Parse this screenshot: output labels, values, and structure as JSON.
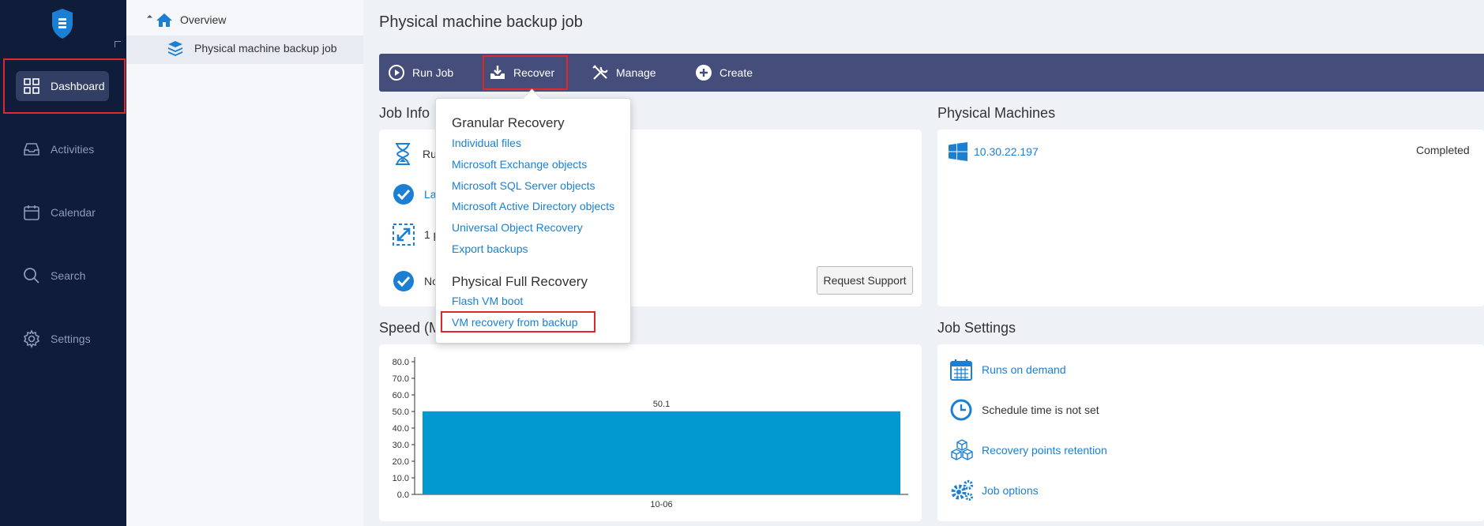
{
  "nav": {
    "items": [
      {
        "label": "Dashboard",
        "icon": "dashboard-grid-icon",
        "active": true
      },
      {
        "label": "Activities",
        "icon": "inbox-tray-icon"
      },
      {
        "label": "Calendar",
        "icon": "calendar-icon"
      },
      {
        "label": "Search",
        "icon": "search-icon"
      },
      {
        "label": "Settings",
        "icon": "gear-icon"
      }
    ]
  },
  "tree": {
    "overview": "Overview",
    "job": "Physical machine backup job"
  },
  "page": {
    "title": "Physical machine backup job"
  },
  "toolbar": {
    "run_job": "Run Job",
    "recover": "Recover",
    "manage": "Manage",
    "create": "Create"
  },
  "job_info": {
    "title": "Job Info",
    "rows": [
      {
        "icon": "hourglass-icon",
        "text": "Ru"
      },
      {
        "icon": "check-circle-icon",
        "text": "La"
      },
      {
        "icon": "resize-arrows-icon",
        "text": "1 p"
      },
      {
        "icon": "check-circle-icon",
        "text": "No"
      }
    ],
    "request_support": "Request Support"
  },
  "physical_machines": {
    "title": "Physical Machines",
    "items": [
      {
        "name": "10.30.22.197",
        "status": "Completed"
      }
    ]
  },
  "speed": {
    "title": "Speed (M"
  },
  "job_settings": {
    "title": "Job Settings",
    "items": [
      {
        "icon": "calendar-icon",
        "label": "Runs on demand",
        "link": true
      },
      {
        "icon": "clock-icon",
        "label": "Schedule time is not set",
        "link": false
      },
      {
        "icon": "cubes-icon",
        "label": "Recovery points retention",
        "link": true
      },
      {
        "icon": "gears-icon",
        "label": "Job options",
        "link": true
      }
    ]
  },
  "recover_menu": {
    "granular_heading": "Granular Recovery",
    "granular_items": [
      "Individual files",
      "Microsoft Exchange objects",
      "Microsoft SQL Server objects",
      "Microsoft Active Directory objects",
      "Universal Object Recovery",
      "Export backups"
    ],
    "full_heading": "Physical Full Recovery",
    "full_items": [
      "Flash VM boot",
      "VM recovery from backup"
    ]
  },
  "colors": {
    "nav_bg": "#0f1d3a",
    "toolbar_bg": "#454d7a",
    "link": "#1b7fd3",
    "bar": "#0199cf",
    "highlight": "#e0272d"
  },
  "chart_data": {
    "type": "bar",
    "categories": [
      "10-06"
    ],
    "values": [
      50.1
    ],
    "yticks": [
      "0.0",
      "10.0",
      "20.0",
      "30.0",
      "40.0",
      "50.0",
      "60.0",
      "70.0",
      "80.0"
    ],
    "ylim": [
      0,
      80
    ],
    "data_labels": [
      "50.1"
    ],
    "grid": false
  }
}
